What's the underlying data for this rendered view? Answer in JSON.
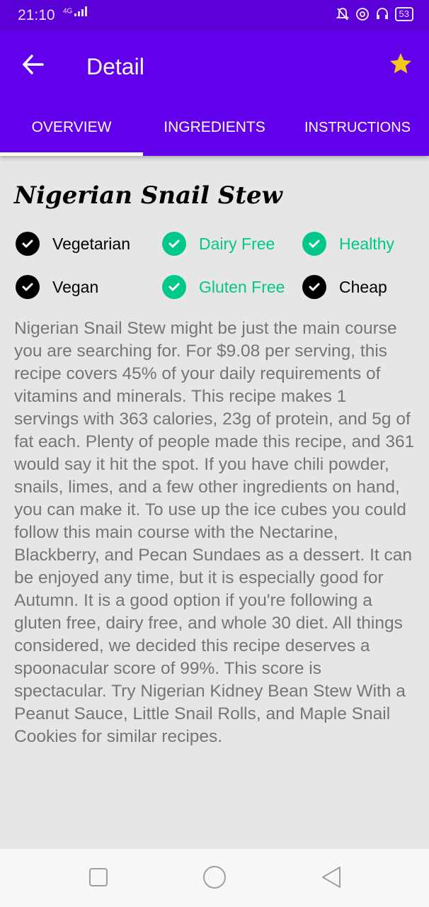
{
  "status_bar": {
    "time": "21:10",
    "network": "4G",
    "battery": "53"
  },
  "app_bar": {
    "title": "Detail",
    "back_icon": "arrow-left-icon",
    "favorite_icon": "star-icon",
    "favorite_color": "#f5c518"
  },
  "tabs": [
    {
      "label": "OVERVIEW",
      "selected": true
    },
    {
      "label": "INGREDIENTS",
      "selected": false
    },
    {
      "label": "INSTRUCTIONS",
      "selected": false
    }
  ],
  "recipe": {
    "title": "Nigerian Snail Stew",
    "tags": [
      {
        "label": "Vegetarian",
        "active": false
      },
      {
        "label": "Dairy Free",
        "active": true
      },
      {
        "label": "Healthy",
        "active": true
      },
      {
        "label": "Vegan",
        "active": false
      },
      {
        "label": "Gluten Free",
        "active": true
      },
      {
        "label": "Cheap",
        "active": false
      }
    ],
    "description": "Nigerian Snail Stew might be just the main course you are searching for. For $9.08 per serving, this recipe covers 45% of your daily requirements of vitamins and minerals. This recipe makes 1 servings with 363 calories, 23g of protein, and 5g of fat each. Plenty of people made this recipe, and 361 would say it hit the spot. If you have chili powder, snails, limes, and a few other ingredients on hand, you can make it. To use up the ice cubes you could follow this main course with the Nectarine, Blackberry, and Pecan Sundaes as a dessert. It can be enjoyed any time, but it is especially good for Autumn. It is a good option if you're following a gluten free, dairy free, and whole 30 diet. All things considered, we decided this recipe deserves a spoonacular score of 99%. This score is spectacular. Try Nigerian Kidney Bean Stew With a Peanut Sauce, Little Snail Rolls, and Maple Snail Cookies for similar recipes."
  },
  "colors": {
    "primary": "#6200ee",
    "status_bar": "#5a00d6",
    "active_tag": "#00c88a",
    "inactive_tag": "#000000",
    "text_secondary": "#757575"
  },
  "nav_bar": {
    "recent_icon": "square-icon",
    "home_icon": "circle-icon",
    "back_icon": "triangle-back-icon"
  }
}
